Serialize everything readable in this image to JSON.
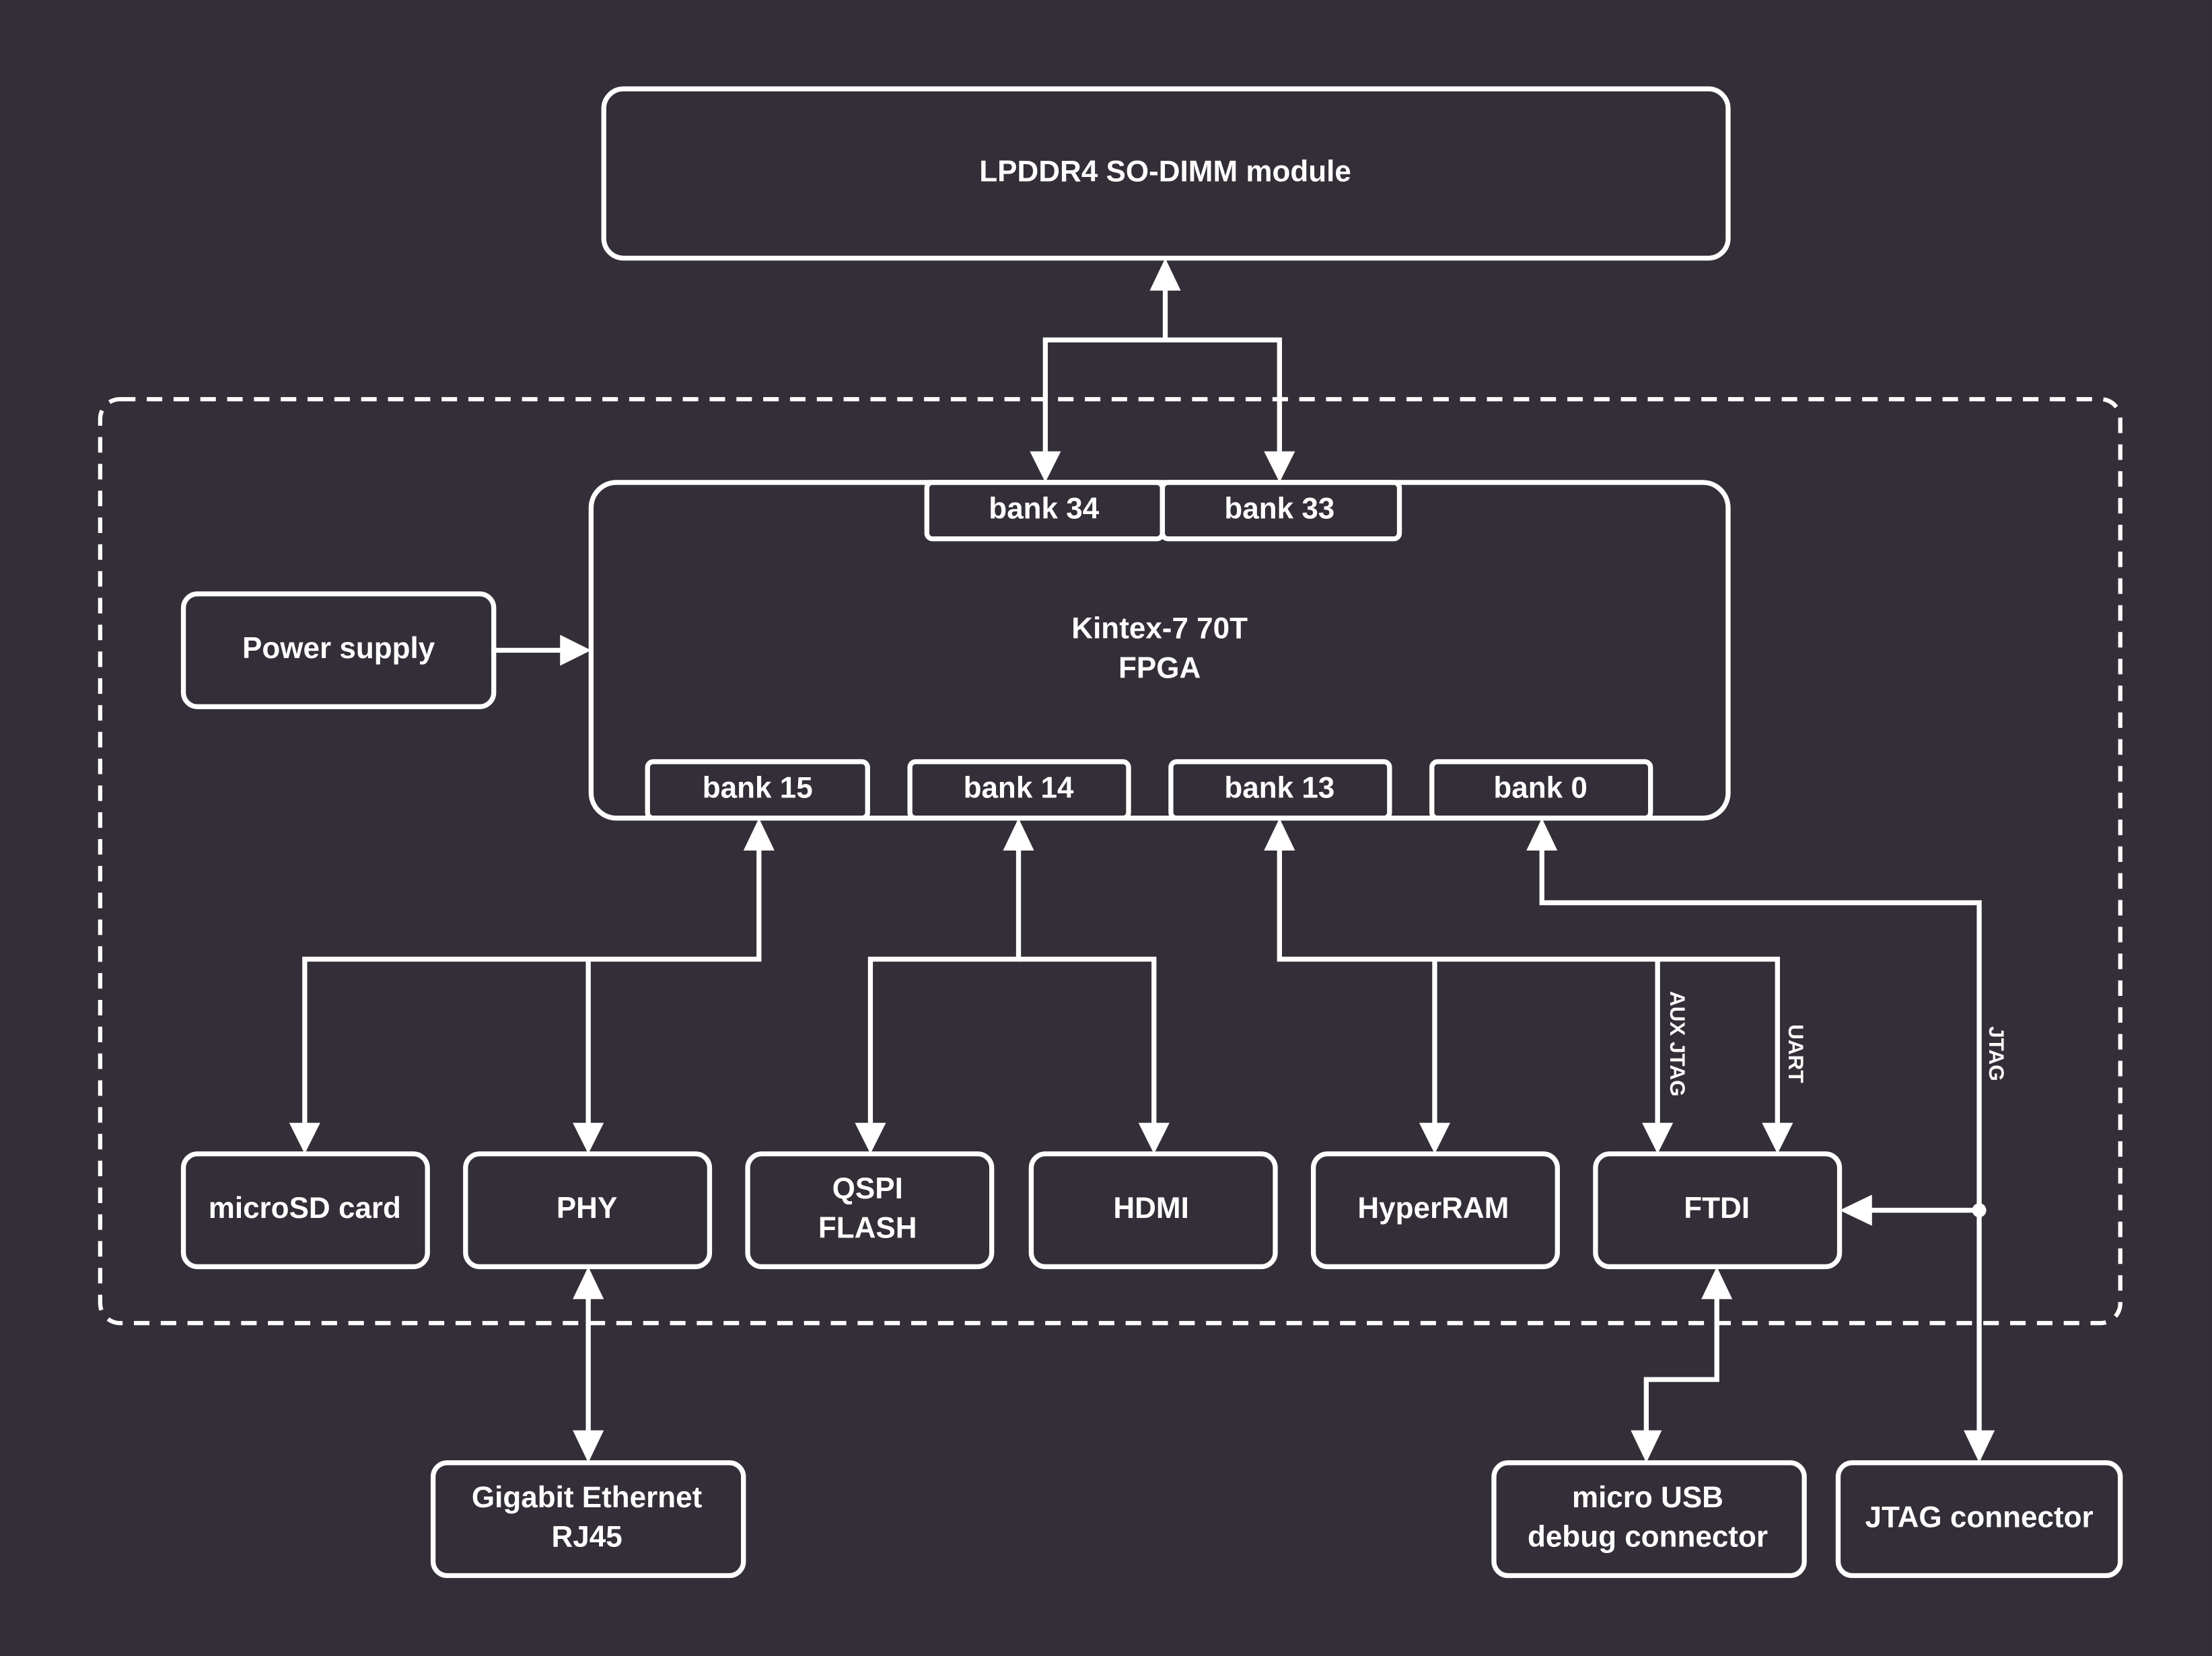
{
  "colors": {
    "background": "#332e37",
    "foreground": "#ffffff"
  },
  "memory": {
    "label": "LPDDR4 SO-DIMM module"
  },
  "fpga": {
    "line1": "Kintex-7 70T",
    "line2": "FPGA"
  },
  "banks": {
    "b34": "bank 34",
    "b33": "bank 33",
    "b15": "bank 15",
    "b14": "bank 14",
    "b13": "bank 13",
    "b0": "bank 0"
  },
  "power": {
    "label": "Power supply"
  },
  "peripherals": {
    "microsd": "microSD card",
    "phy": "PHY",
    "qspi1": "QSPI",
    "qspi2": "FLASH",
    "hdmi": "HDMI",
    "hyperram": "HyperRAM",
    "ftdi": "FTDI"
  },
  "external": {
    "eth1": "Gigabit Ethernet",
    "eth2": "RJ45",
    "usb1": "micro USB",
    "usb2": "debug connector",
    "jtag": "JTAG connector"
  },
  "signals": {
    "aux_jtag": "AUX JTAG",
    "uart": "UART",
    "jtag": "JTAG"
  }
}
